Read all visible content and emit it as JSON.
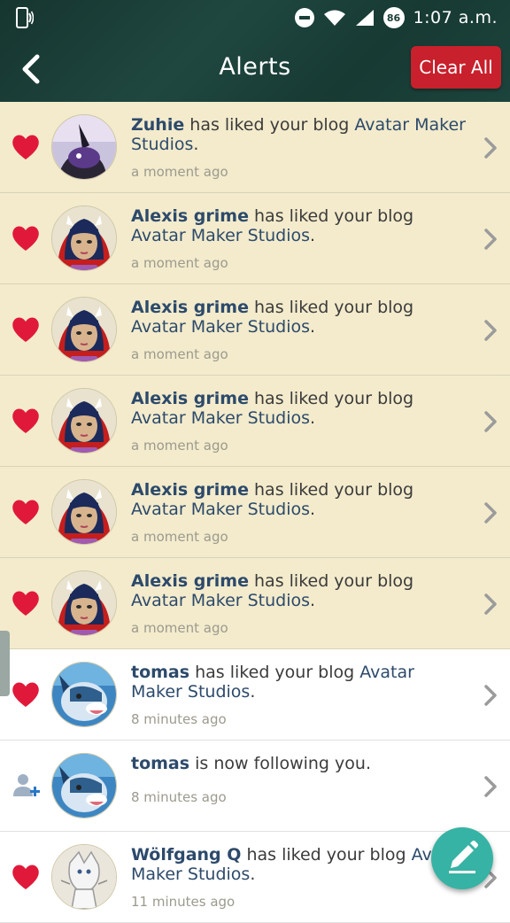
{
  "status_bar": {
    "time": "1:07 a.m.",
    "badge": "86"
  },
  "header": {
    "title": "Alerts",
    "clear_label": "Clear All"
  },
  "alerts": [
    {
      "user": "Zuhie",
      "action": " has liked your blog ",
      "target": "Avatar Maker Studios",
      "suffix": ".",
      "time": "a moment ago",
      "icon": "heart-icon",
      "state": "unread"
    },
    {
      "user": "Alexis grime",
      "action": " has liked your blog ",
      "target": "Avatar Maker Studios",
      "suffix": ".",
      "time": "a moment ago",
      "icon": "heart-icon",
      "state": "unread"
    },
    {
      "user": "Alexis grime",
      "action": " has liked your blog ",
      "target": "Avatar Maker Studios",
      "suffix": ".",
      "time": "a moment ago",
      "icon": "heart-icon",
      "state": "unread"
    },
    {
      "user": "Alexis grime",
      "action": " has liked your blog ",
      "target": "Avatar Maker Studios",
      "suffix": ".",
      "time": "a moment ago",
      "icon": "heart-icon",
      "state": "unread"
    },
    {
      "user": "Alexis grime",
      "action": " has liked your blog ",
      "target": "Avatar Maker Studios",
      "suffix": ".",
      "time": "a moment ago",
      "icon": "heart-icon",
      "state": "unread"
    },
    {
      "user": "Alexis grime",
      "action": " has liked your blog ",
      "target": "Avatar Maker Studios",
      "suffix": ".",
      "time": "a moment ago",
      "icon": "heart-icon",
      "state": "unread"
    },
    {
      "user": "tomas",
      "action": " has liked your blog ",
      "target": "Avatar Maker Studios",
      "suffix": ".",
      "time": "8 minutes ago",
      "icon": "heart-icon",
      "state": "read"
    },
    {
      "user": "tomas",
      "action": " is now following you.",
      "target": "",
      "suffix": "",
      "time": "8 minutes ago",
      "icon": "add-user-icon",
      "state": "read"
    },
    {
      "user": "Wölfgang Q",
      "action": " has liked your blog ",
      "target": "Avatar Maker Studios",
      "suffix": ".",
      "time": "11 minutes ago",
      "icon": "heart-icon",
      "state": "read"
    }
  ],
  "colors": {
    "header_bg": "#1f4740",
    "clear_button": "#c8202c",
    "unread_bg": "#f3ebcc",
    "heart": "#e0193a",
    "link": "#2d4a6b",
    "fab": "#36b3a4"
  }
}
